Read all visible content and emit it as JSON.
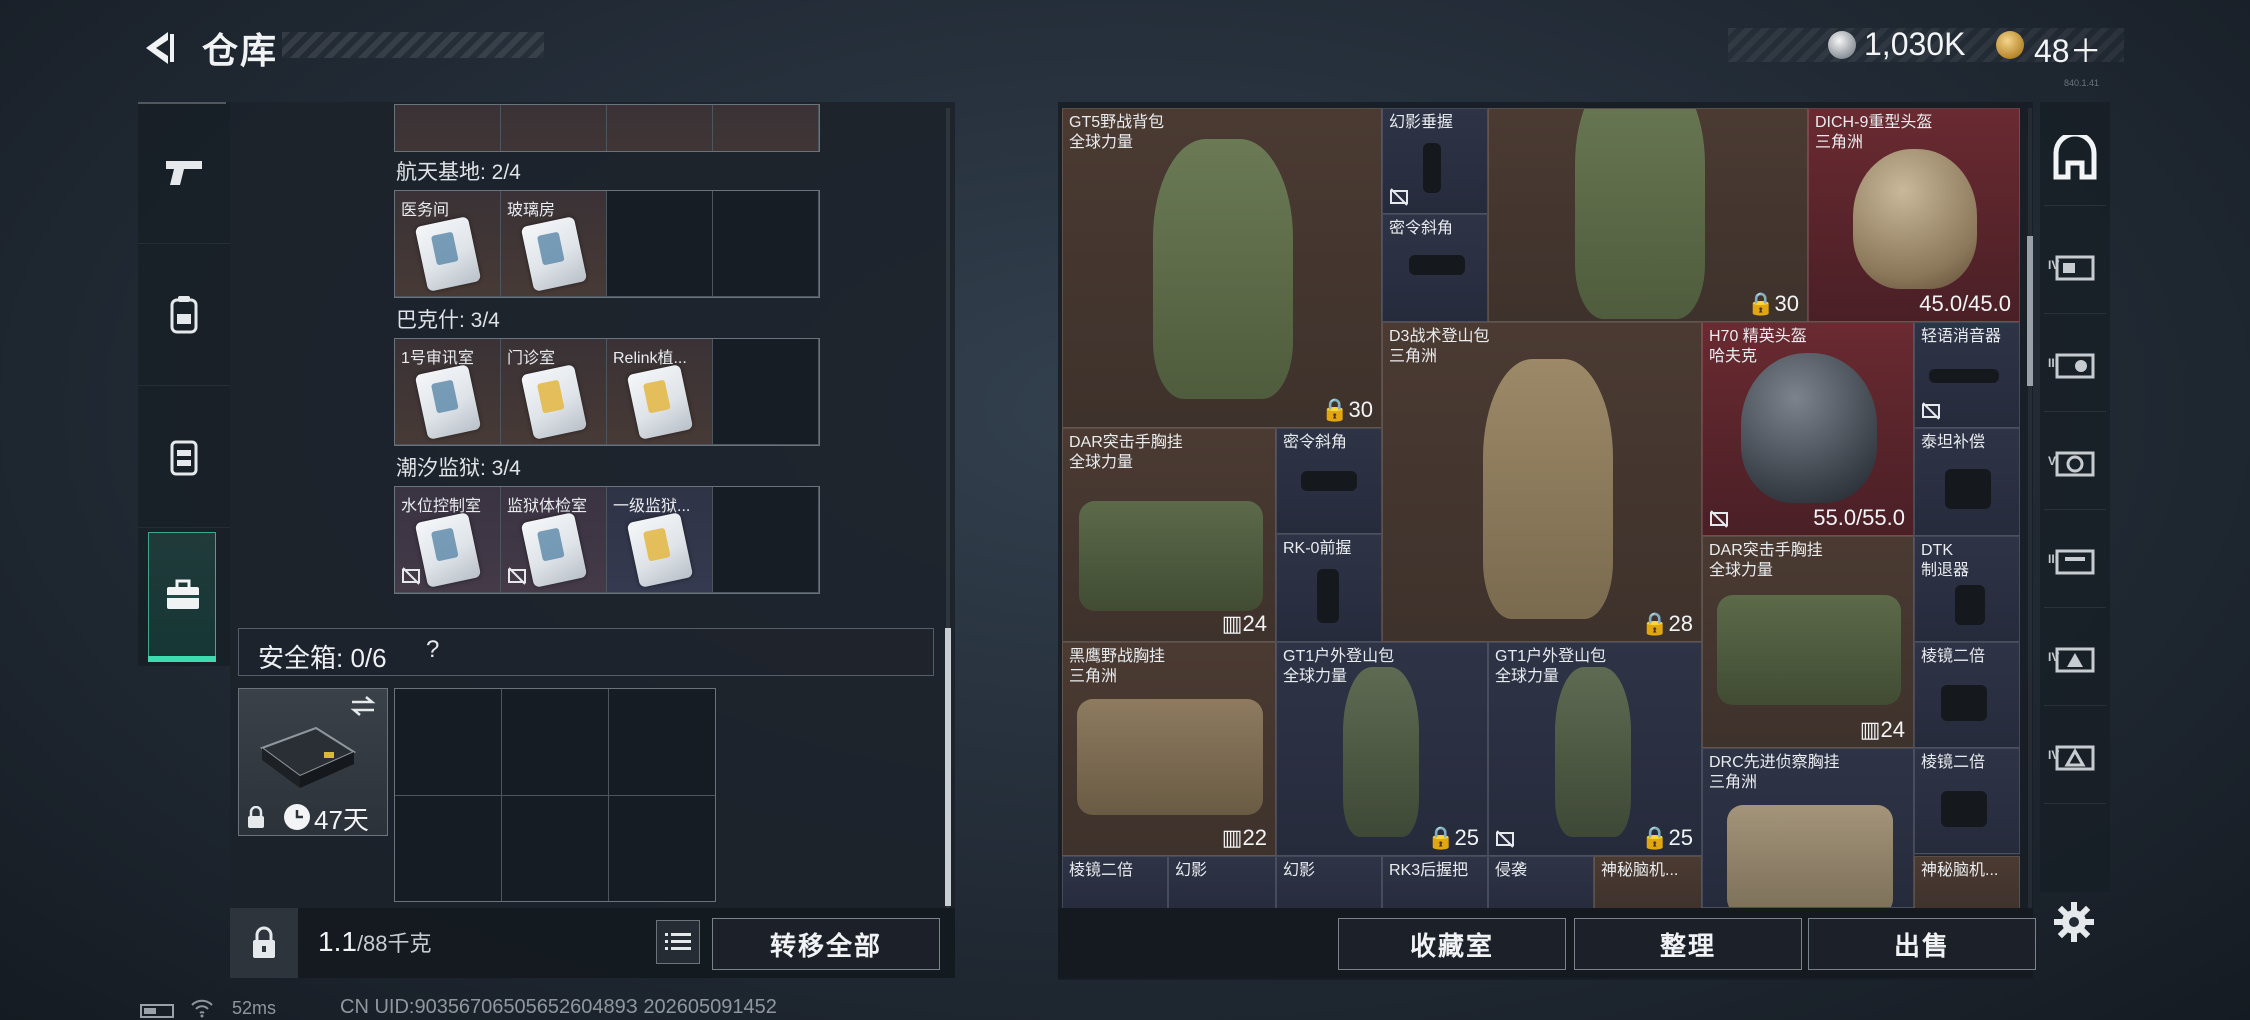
{
  "header": {
    "title": "仓库",
    "silver_value": "1,030K",
    "gold_value": "48＋",
    "version": "840.1.41"
  },
  "left_rail": {
    "items": [
      {
        "icon": "pistol-icon"
      },
      {
        "icon": "backpack-icon"
      },
      {
        "icon": "vest-icon"
      },
      {
        "icon": "toolbox-icon",
        "active": true
      }
    ]
  },
  "container": {
    "groups": [
      {
        "label": "航天基地: 2/4",
        "cards": [
          "医务间",
          "玻璃房",
          "",
          ""
        ]
      },
      {
        "label": "巴克什: 3/4",
        "cards": [
          "1号审讯室",
          "门诊室",
          "Relink植...",
          ""
        ]
      },
      {
        "label": "潮汐监狱: 3/4",
        "cards": [
          "水位控制室",
          "监狱体检室",
          "一级监狱...",
          ""
        ]
      }
    ],
    "safebox_label": "安全箱: 0/6",
    "help": "?",
    "safebox_days": "47天",
    "weight_value": "1.1",
    "weight_unit": "/88千克",
    "transfer_all": "转移全部"
  },
  "stash": {
    "items": [
      {
        "name": "GT5野战背包",
        "sub": "全球力量",
        "value": "30"
      },
      {
        "name": "幻影垂握",
        "sub": "",
        "value": ""
      },
      {
        "name": "密令斜角",
        "sub": "",
        "value": ""
      },
      {
        "name": "",
        "sub": "",
        "value": "30"
      },
      {
        "name": "DICH-9重型头盔",
        "sub": "三角洲",
        "value": "45.0/45.0"
      },
      {
        "name": "D3战术登山包",
        "sub": "三角洲",
        "value": "28"
      },
      {
        "name": "H70 精英头盔",
        "sub": "哈夫克",
        "value": "55.0/55.0"
      },
      {
        "name": "轻语消音器",
        "sub": "",
        "value": ""
      },
      {
        "name": "DAR突击手胸挂",
        "sub": "全球力量",
        "value": "24"
      },
      {
        "name": "密令斜角",
        "sub": "",
        "value": ""
      },
      {
        "name": "RK-0前握",
        "sub": "",
        "value": ""
      },
      {
        "name": "泰坦补偿",
        "sub": "",
        "value": ""
      },
      {
        "name": "DAR突击手胸挂",
        "sub": "全球力量",
        "value": "24"
      },
      {
        "name": "DTK",
        "sub": "制退器",
        "value": ""
      },
      {
        "name": "黑鹰野战胸挂",
        "sub": "三角洲",
        "value": "22"
      },
      {
        "name": "GT1户外登山包",
        "sub": "全球力量",
        "value": "25"
      },
      {
        "name": "GT1户外登山包",
        "sub": "全球力量",
        "value": "25"
      },
      {
        "name": "棱镜二倍",
        "sub": "",
        "value": ""
      },
      {
        "name": "DRC先进侦察胸挂",
        "sub": "三角洲",
        "value": ""
      },
      {
        "name": "棱镜二倍",
        "sub": "",
        "value": ""
      },
      {
        "name": "棱镜二倍",
        "sub": "",
        "value": ""
      },
      {
        "name": "幻影",
        "sub": "",
        "value": ""
      },
      {
        "name": "幻影",
        "sub": "",
        "value": ""
      },
      {
        "name": "RK3后握把",
        "sub": "",
        "value": ""
      },
      {
        "name": "侵袭",
        "sub": "",
        "value": ""
      },
      {
        "name": "神秘脑机...",
        "sub": "",
        "value": ""
      },
      {
        "name": "神秘脑机...",
        "sub": "",
        "value": ""
      }
    ],
    "buttons": {
      "collection": "收藏室",
      "sort": "整理",
      "sell": "出售"
    }
  },
  "right_tabs": {
    "labels": [
      "IV",
      "III",
      "V",
      "III",
      "IV",
      "IV"
    ]
  },
  "status": {
    "ping": "52ms",
    "uid": "CN UID:9035670650565260489З  202605091452"
  },
  "colors": {
    "accent": "#3ddbb0",
    "brown_cell": "#4a3a32",
    "blue_cell": "#2e3346",
    "red_cell": "#6a2a31"
  }
}
